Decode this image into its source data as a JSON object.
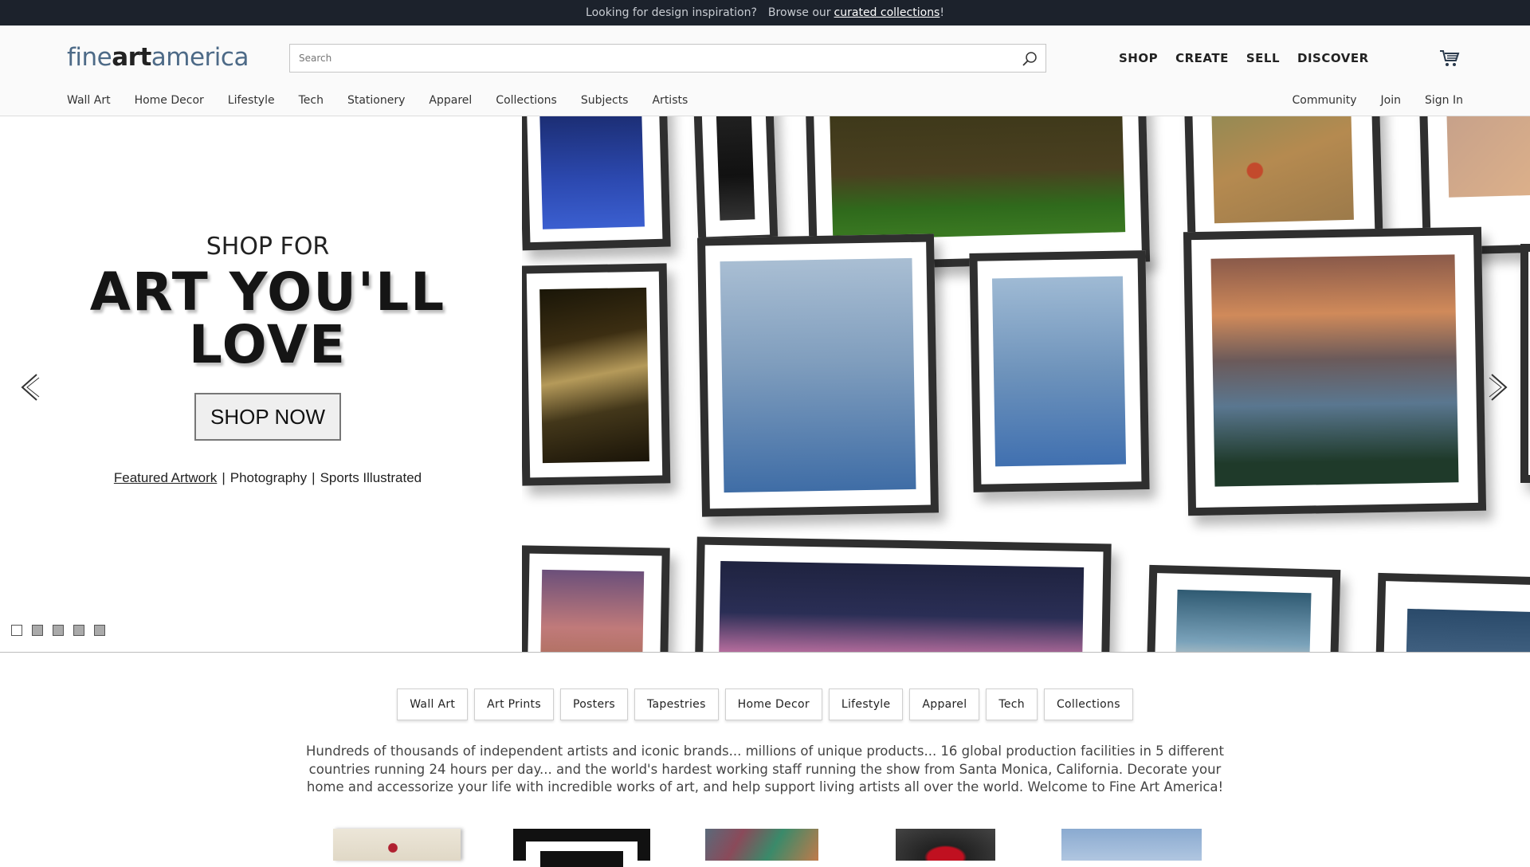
{
  "topbar": {
    "prefix": "Looking for design inspiration?",
    "browse": "Browse our",
    "link": "curated collections",
    "suffix": "!"
  },
  "header": {
    "logo_a": "fine",
    "logo_b": "art",
    "logo_c": "america",
    "search_placeholder": "Search",
    "mainnav": [
      "SHOP",
      "CREATE",
      "SELL",
      "DISCOVER"
    ],
    "subnav": [
      "Wall Art",
      "Home Decor",
      "Lifestyle",
      "Tech",
      "Stationery",
      "Apparel",
      "Collections",
      "Subjects",
      "Artists"
    ],
    "rightnav": [
      "Community",
      "Join",
      "Sign In"
    ]
  },
  "hero": {
    "shopfor": "SHOP FOR",
    "headline_1": "ART YOU'LL",
    "headline_2": "LOVE",
    "cta": "SHOP NOW",
    "links": [
      "Featured Artwork",
      "Photography",
      "Sports Illustrated"
    ],
    "slides": 5,
    "active_slide": 1
  },
  "chips": [
    "Wall Art",
    "Art Prints",
    "Posters",
    "Tapestries",
    "Home Decor",
    "Lifestyle",
    "Apparel",
    "Tech",
    "Collections"
  ],
  "intro": "Hundreds of thousands of independent artists and iconic brands... millions of unique products... 16 global production facilities in 5 different countries running 24 hours per day... and the world's hardest working staff running the show from Santa Monica, California.   Decorate your home and accessorize your life with incredible works of art, and help support living artists all over the world.   Welcome to Fine Art America!"
}
